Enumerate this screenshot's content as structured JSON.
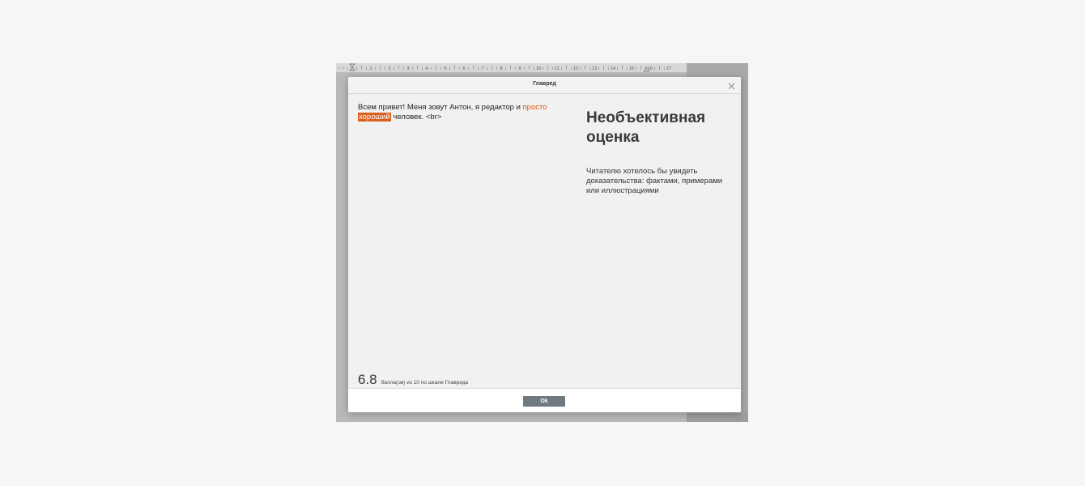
{
  "dialog": {
    "title": "Главред",
    "close_icon": "close-icon"
  },
  "ruler": {
    "numbers": [
      "1",
      "2",
      "3",
      "4",
      "5",
      "6",
      "7",
      "8",
      "9",
      "10",
      "11",
      "12",
      "13",
      "14",
      "15",
      "16",
      "17"
    ]
  },
  "editor": {
    "text_before": "Всем привет! Меня зовут Антон, я редактор и ",
    "highlight_1": "просто",
    "space": " ",
    "highlight_2": "хороший",
    "text_after": " человек. <br>"
  },
  "side_panel": {
    "title": "Необъективная оценка",
    "description": "Читателю хотелось бы увидеть доказательства: фактами, примерами или иллюстрациями"
  },
  "score": {
    "value": "6.8",
    "caption": "балла(ов) из 10 по шкале Главреда"
  },
  "footer": {
    "ok_label": "Ok"
  },
  "colors": {
    "highlight": "#d9601e",
    "ok_button": "#6f7a80"
  }
}
